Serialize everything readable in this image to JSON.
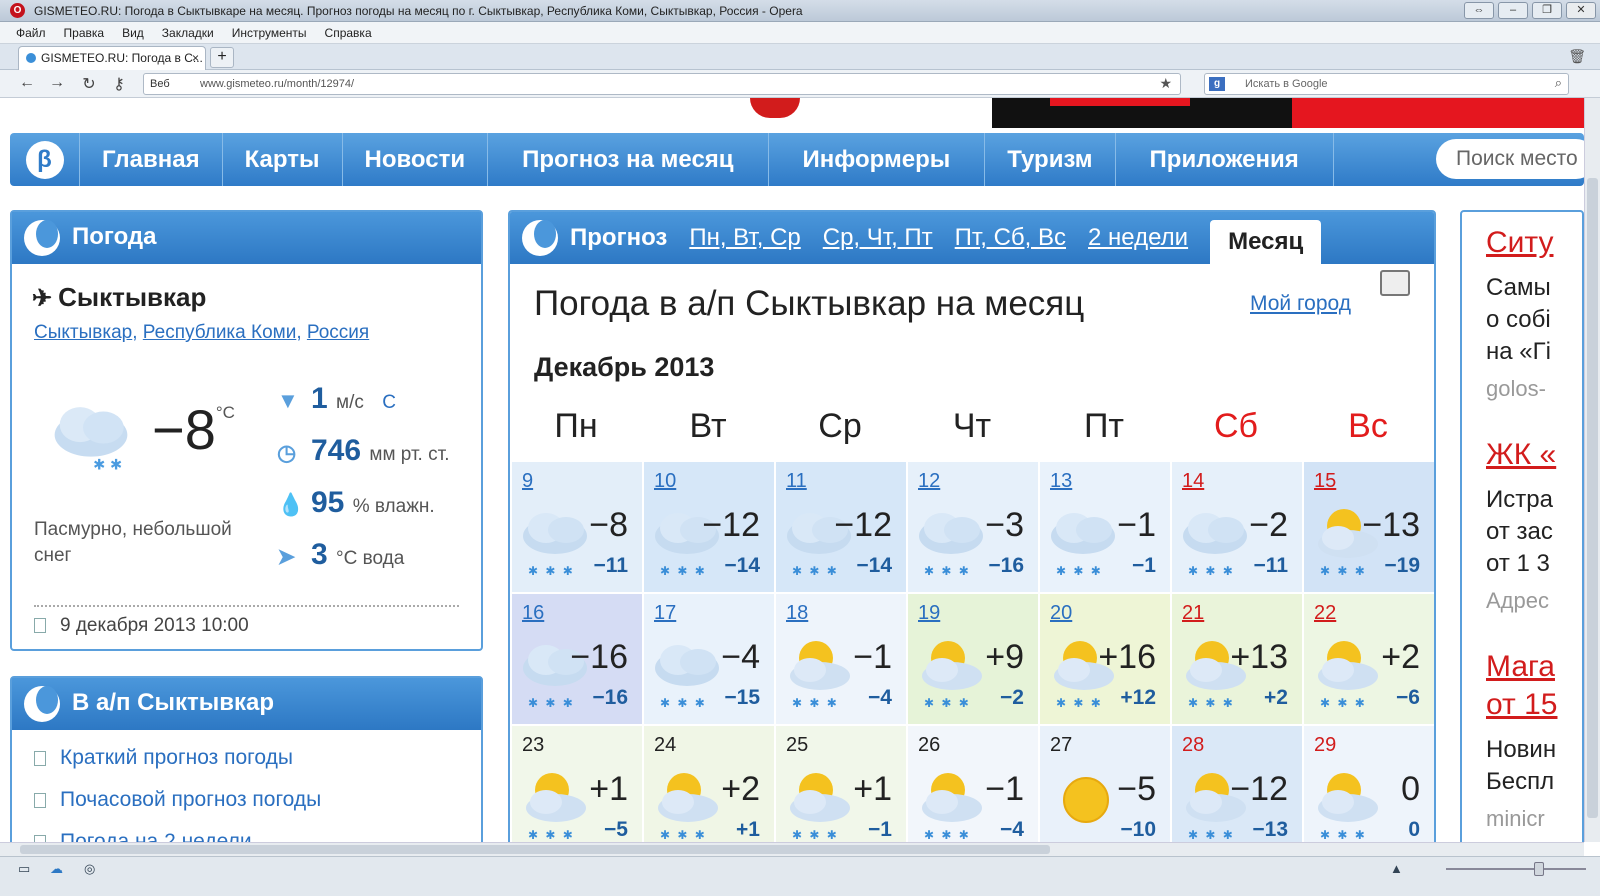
{
  "window": {
    "title": "GISMETEO.RU: Погода в Сыктывкаре на месяц. Прогноз погоды на месяц по г. Сыктывкар, Республика Коми, Сыктывкар, Россия - Opera"
  },
  "menu": [
    "Файл",
    "Правка",
    "Вид",
    "Закладки",
    "Инструменты",
    "Справка"
  ],
  "tab": {
    "label": "GISMETEO.RU: Погода в С...",
    "close": "×",
    "new": "+"
  },
  "address": {
    "web": "Веб",
    "url": "www.gismeteo.ru/month/12974/"
  },
  "search": {
    "placeholder": "Искать в Google"
  },
  "site_nav": {
    "logo": "β",
    "items": [
      "Главная",
      "Карты",
      "Новости",
      "Прогноз на месяц",
      "Информеры",
      "Туризм",
      "Приложения"
    ],
    "search_placeholder": "Поиск место"
  },
  "weather_panel": {
    "title": "Погода",
    "city": "Сыктывкар",
    "region": [
      "Сыктывкар",
      "Республика Коми",
      "Россия"
    ],
    "temp": "−8",
    "temp_unit": "°C",
    "desc": "Пасмурно, небольшой снег",
    "wind_value": "1",
    "wind_unit": "м/с",
    "wind_dir": "С",
    "pressure_value": "746",
    "pressure_unit": "мм рт. ст.",
    "humidity_value": "95",
    "humidity_unit": "% влажн.",
    "water_value": "3",
    "water_unit": "°С вода",
    "datetime": "9 декабря 2013 10:00"
  },
  "airport_panel": {
    "title": "В а/п Сыктывкар",
    "links": [
      "Краткий прогноз погоды",
      "Почасовой прогноз погоды",
      "Погода на 2 недели"
    ]
  },
  "forecast": {
    "header": "Прогноз",
    "tabs": [
      "Пн, Вт, Ср",
      "Ср, Чт, Пт",
      "Пт, Сб, Вс",
      "2 недели"
    ],
    "active_tab": "Месяц",
    "title": "Погода в а/п Сыктывкар на месяц",
    "my_city": "Мой город",
    "month": "Декабрь 2013",
    "weekdays": [
      "Пн",
      "Вт",
      "Ср",
      "Чт",
      "Пт",
      "Сб",
      "Вс"
    ],
    "days": [
      {
        "d": "9",
        "day": "−8",
        "night": "−11",
        "icon": "cloud-snow",
        "bg": "#e3eef9"
      },
      {
        "d": "10",
        "day": "−12",
        "night": "−14",
        "icon": "cloud-snow",
        "bg": "#d6e7f8"
      },
      {
        "d": "11",
        "day": "−12",
        "night": "−14",
        "icon": "cloud-snow",
        "bg": "#d6e7f8"
      },
      {
        "d": "12",
        "day": "−3",
        "night": "−16",
        "icon": "cloud-snow",
        "bg": "#e6f0fa"
      },
      {
        "d": "13",
        "day": "−1",
        "night": "−1",
        "icon": "cloud-snow",
        "bg": "#e9f2fb"
      },
      {
        "d": "14",
        "day": "−2",
        "night": "−11",
        "icon": "cloud-snow",
        "bg": "#e6f0fa"
      },
      {
        "d": "15",
        "day": "−13",
        "night": "−19",
        "icon": "sun-cloud",
        "bg": "#d2e3f6"
      },
      {
        "d": "16",
        "day": "−16",
        "night": "−16",
        "icon": "cloud",
        "bg": "#d5dcf4"
      },
      {
        "d": "17",
        "day": "−4",
        "night": "−15",
        "icon": "cloud-snow",
        "bg": "#e9f2fb"
      },
      {
        "d": "18",
        "day": "−1",
        "night": "−4",
        "icon": "sun-cloud",
        "bg": "#eef4fb"
      },
      {
        "d": "19",
        "day": "+9",
        "night": "−2",
        "icon": "sun-cloud",
        "bg": "#e6f3d8"
      },
      {
        "d": "20",
        "day": "+16",
        "night": "+12",
        "icon": "sun-cloud",
        "bg": "#eef5d6"
      },
      {
        "d": "21",
        "day": "+13",
        "night": "+2",
        "icon": "sun-cloud",
        "bg": "#eaf4da"
      },
      {
        "d": "22",
        "day": "+2",
        "night": "−6",
        "icon": "sun-cloud",
        "bg": "#edf6e3"
      },
      {
        "d": "23",
        "day": "+1",
        "night": "−5",
        "icon": "sun-cloud",
        "bg": "#f1f7ea"
      },
      {
        "d": "24",
        "day": "+2",
        "night": "+1",
        "icon": "sun-cloud",
        "bg": "#f0f6e6"
      },
      {
        "d": "25",
        "day": "+1",
        "night": "−1",
        "icon": "sun-cloud",
        "bg": "#f1f7ea"
      },
      {
        "d": "26",
        "day": "−1",
        "night": "−4",
        "icon": "sun-cloud",
        "bg": "#f2f6fb"
      },
      {
        "d": "27",
        "day": "−5",
        "night": "−10",
        "icon": "sun",
        "bg": "#e9f1fa"
      },
      {
        "d": "28",
        "day": "−12",
        "night": "−13",
        "icon": "sun-cloud",
        "bg": "#dae8f7"
      },
      {
        "d": "29",
        "day": "0",
        "night": "0",
        "icon": "sun-cloud",
        "bg": "#eef4fb"
      }
    ]
  },
  "right_panel": {
    "items": [
      {
        "head": "Ситу",
        "lines": [
          "Самы",
          "о собі",
          "на «Гі"
        ],
        "gray": "golos-"
      },
      {
        "head": "ЖК «",
        "lines": [
          "Истра",
          "от зас",
          "от 1 3"
        ],
        "gray": "Адрес"
      },
      {
        "head": "Мага",
        "head2": "от 15",
        "lines": [
          "Новин",
          "Беспл"
        ],
        "gray": "minicr"
      }
    ]
  },
  "colors": {
    "accent": "#2f7bc8",
    "weekend": "#e21c1c",
    "link": "#2a6fc0"
  }
}
